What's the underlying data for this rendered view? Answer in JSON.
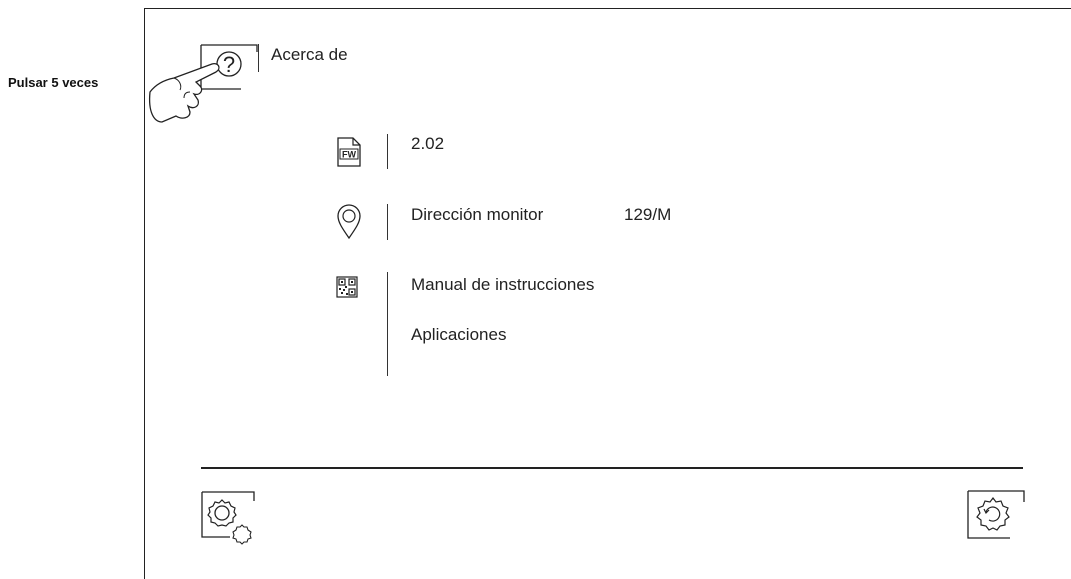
{
  "hint": {
    "label": "Pulsar 5 veces"
  },
  "header": {
    "title": "Acerca de"
  },
  "firmware": {
    "icon": "fw-file-icon",
    "icon_text": "FW",
    "value": "2.02"
  },
  "address": {
    "icon": "location-pin-icon",
    "label": "Dirección monitor",
    "value": "129/M"
  },
  "qr": {
    "icon": "qr-code-icon",
    "items": [
      "Manual de instrucciones",
      "Aplicaciones"
    ]
  },
  "footer": {
    "left_icon": "settings-gears-icon",
    "right_icon": "reset-settings-icon"
  }
}
